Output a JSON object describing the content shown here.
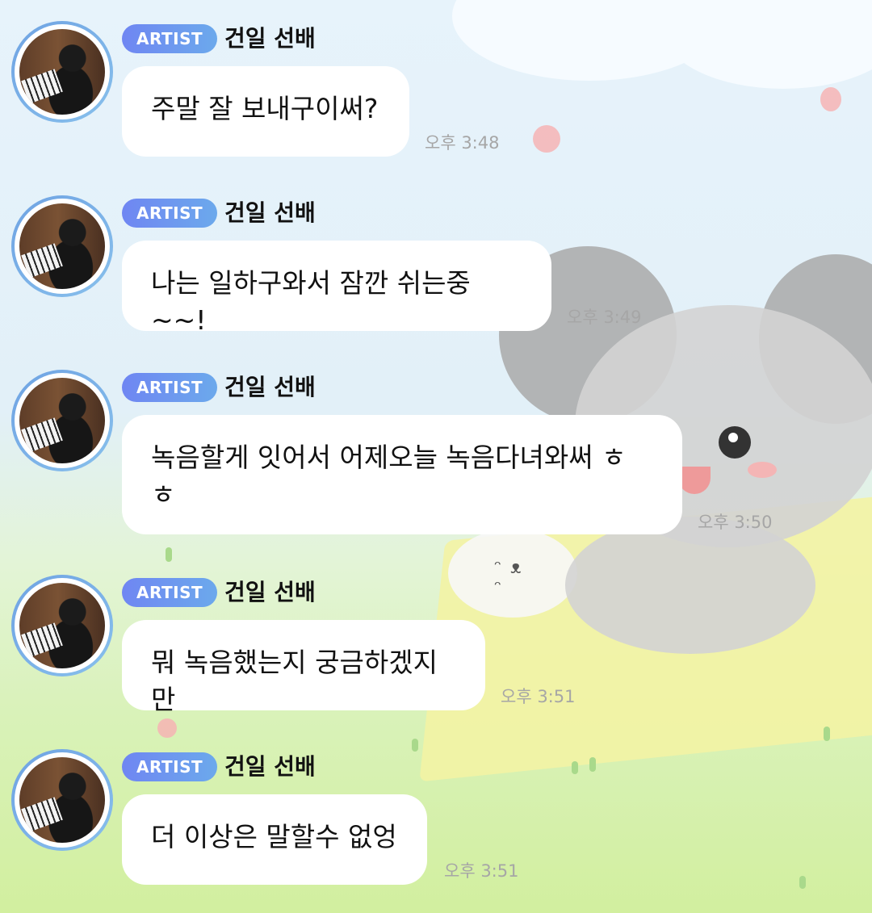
{
  "chat": {
    "messages": [
      {
        "badge": "ARTIST",
        "sender": "건일 선배",
        "text": "주말 잘 보내구이써?",
        "time": "오후 3:48"
      },
      {
        "badge": "ARTIST",
        "sender": "건일 선배",
        "text": "나는 일하구와서 잠깐 쉬는중~~!",
        "time": "오후 3:49"
      },
      {
        "badge": "ARTIST",
        "sender": "건일 선배",
        "text": "녹음할게 잇어서 어제오늘 녹음다녀와써 ㅎㅎ",
        "time": "오후 3:50"
      },
      {
        "badge": "ARTIST",
        "sender": "건일 선배",
        "text": "뭐 녹음했는지 궁금하겠지만",
        "time": "오후 3:51"
      },
      {
        "badge": "ARTIST",
        "sender": "건일 선배",
        "text": "더 이상은 말할수 없엉",
        "time": "오후 3:51"
      }
    ]
  },
  "colors": {
    "badge_gradient_start": "#6f86f2",
    "badge_gradient_end": "#6ca9ec",
    "bubble": "#ffffff",
    "timestamp": "#a6a6a6"
  },
  "icons": {
    "avatar": "profile-photo-piano"
  }
}
